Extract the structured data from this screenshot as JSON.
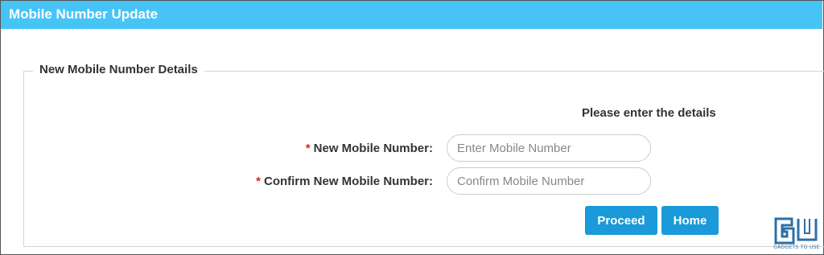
{
  "header": {
    "title": "Mobile Number Update"
  },
  "form": {
    "legend": "New Mobile Number Details",
    "instructions": "Please enter the details",
    "fields": [
      {
        "required_mark": "*",
        "label": "New Mobile Number:",
        "value": "",
        "placeholder": "Enter Mobile Number"
      },
      {
        "required_mark": "*",
        "label": "Confirm New Mobile Number:",
        "value": "",
        "placeholder": "Confirm Mobile Number"
      }
    ],
    "buttons": {
      "proceed_label": "Proceed",
      "home_label": "Home"
    }
  },
  "watermark": {
    "logo_text": "GU",
    "caption": "GADGETS TO USE"
  },
  "colors": {
    "header_bg": "#47c4f6",
    "button_bg": "#1a9ad8",
    "required": "#e02020",
    "watermark": "#2c6fa6"
  },
  "icons": {
    "watermark_logo": "gadgets-to-use-logo"
  }
}
